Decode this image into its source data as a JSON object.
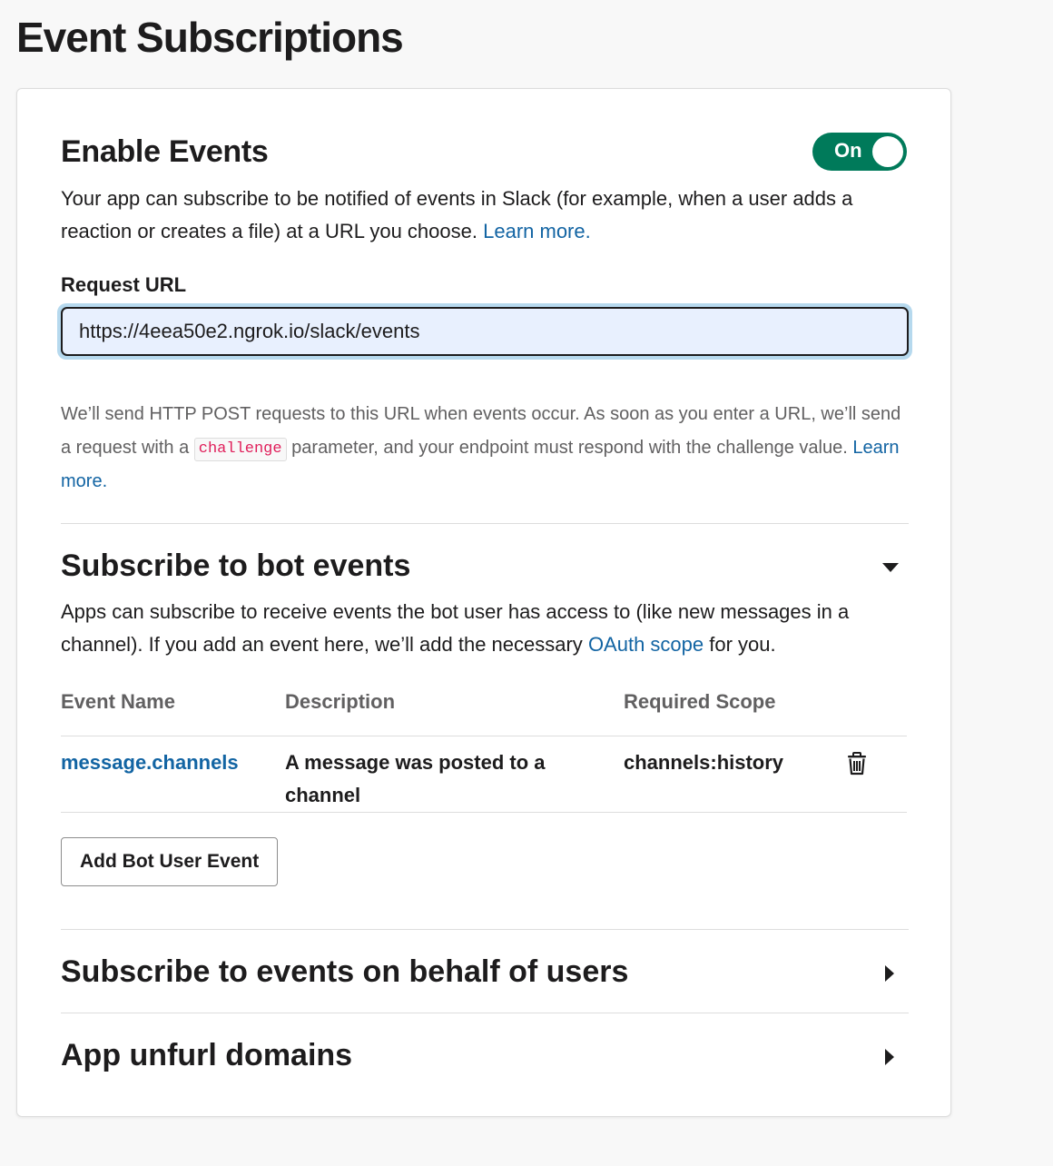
{
  "page": {
    "title": "Event Subscriptions"
  },
  "enable_events": {
    "title": "Enable Events",
    "toggle_label": "On",
    "toggle_state": "on",
    "toggle_color": "#007a5a",
    "description": "Your app can subscribe to be notified of events in Slack (for example, when a user adds a reaction or creates a file) at a URL you choose.",
    "learn_more": "Learn more."
  },
  "request_url": {
    "label": "Request URL",
    "value": "https://4eea50e2.ngrok.io/slack/events",
    "help_prefix": "We’ll send HTTP POST requests to this URL when events occur. As soon as you enter a URL, we’ll send a request with a",
    "help_code": "challenge",
    "help_suffix": "parameter, and your endpoint must respond with the challenge value.",
    "learn_more": "Learn more."
  },
  "bot_events": {
    "title": "Subscribe to bot events",
    "expanded": true,
    "description_prefix": "Apps can subscribe to receive events the bot user has access to (like new messages in a channel). If you add an event here, we’ll add the necessary",
    "description_link": "OAuth scope",
    "description_suffix": "for you.",
    "columns": [
      "Event Name",
      "Description",
      "Required Scope"
    ],
    "rows": [
      {
        "event": "message.channels",
        "description": "A message was posted to a channel",
        "scope": "channels:history",
        "action_icon": "trash-icon"
      }
    ],
    "add_button": "Add Bot User Event"
  },
  "user_events": {
    "title": "Subscribe to events on behalf of users",
    "expanded": false
  },
  "unfurl": {
    "title": "App unfurl domains",
    "expanded": false
  },
  "colors": {
    "link": "#1264a3",
    "code": "#e01e5a",
    "input_focus": "#b6d9ee"
  }
}
